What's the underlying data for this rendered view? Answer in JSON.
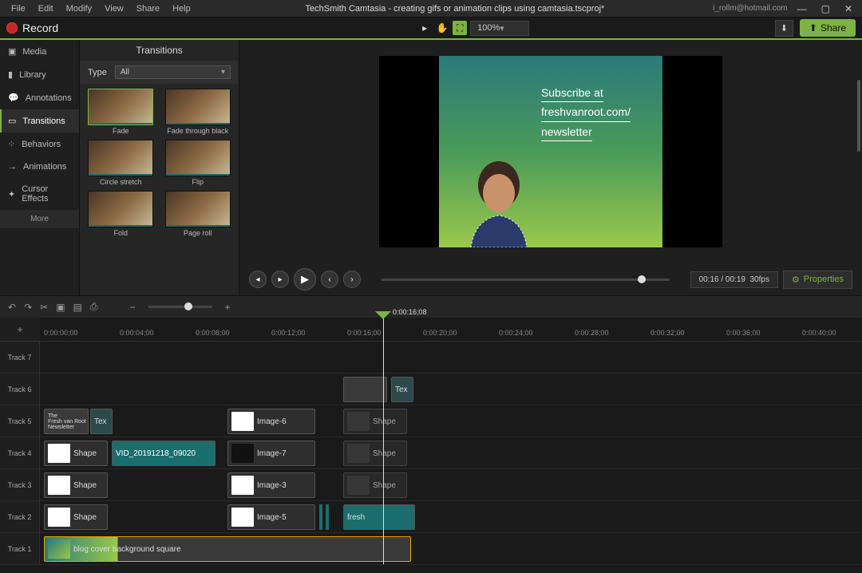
{
  "menu": {
    "file": "File",
    "edit": "Edit",
    "modify": "Modify",
    "view": "View",
    "share": "Share",
    "help": "Help"
  },
  "title": "TechSmith Camtasia - creating gifs or animation clips using camtasia.tscproj*",
  "user": "i_rollm@hotmail.com",
  "record": "Record",
  "zoom": "100%",
  "share_btn": "Share",
  "sidebar": {
    "items": [
      {
        "icon": "▣",
        "label": "Media"
      },
      {
        "icon": "▮",
        "label": "Library"
      },
      {
        "icon": "💬",
        "label": "Annotations"
      },
      {
        "icon": "▭",
        "label": "Transitions"
      },
      {
        "icon": "⁘",
        "label": "Behaviors"
      },
      {
        "icon": "→",
        "label": "Animations"
      },
      {
        "icon": "✦",
        "label": "Cursor Effects"
      }
    ],
    "more": "More"
  },
  "panel": {
    "title": "Transitions",
    "type_label": "Type",
    "type_value": "All",
    "items": [
      "Fade",
      "Fade through black",
      "Circle stretch",
      "Flip",
      "Fold",
      "Page roll"
    ]
  },
  "preview": {
    "line1": "Subscribe at",
    "line2": "freshvanroot.com/",
    "line3": "newsletter"
  },
  "playback": {
    "time": "00:16 / 00:19",
    "fps": "30fps"
  },
  "properties": "Properties",
  "playhead_time": "0:00:16;08",
  "ruler": [
    "0:00:00;00",
    "0:00:04;00",
    "0:00:08;00",
    "0:00:12;00",
    "0:00:16;00",
    "0:00:20;00",
    "0:00:24;00",
    "0:00:28;00",
    "0:00:32;00",
    "0:00:36;00",
    "0:00:40;00"
  ],
  "tracks": [
    "Track 7",
    "Track 6",
    "Track 5",
    "Track 4",
    "Track 3",
    "Track 2",
    "Track 1"
  ],
  "clips": {
    "t6_tex": "Tex",
    "t5_news": "The\nFresh van Root\nNewsletter",
    "t5_tex": "Tex",
    "t5_img6": "Image-6",
    "t5_shape": "Shape",
    "t4_shape": "Shape",
    "t4_vid": "VID_20191218_09020",
    "t4_img7": "Image-7",
    "t4_shape2": "Shape",
    "t3_shape": "Shape",
    "t3_img3": "Image-3",
    "t3_shape2": "Shape",
    "t2_shape": "Shape",
    "t2_img5": "Image-5",
    "t2_fresh": "fresh",
    "t1_bg": "blog cover background square"
  }
}
